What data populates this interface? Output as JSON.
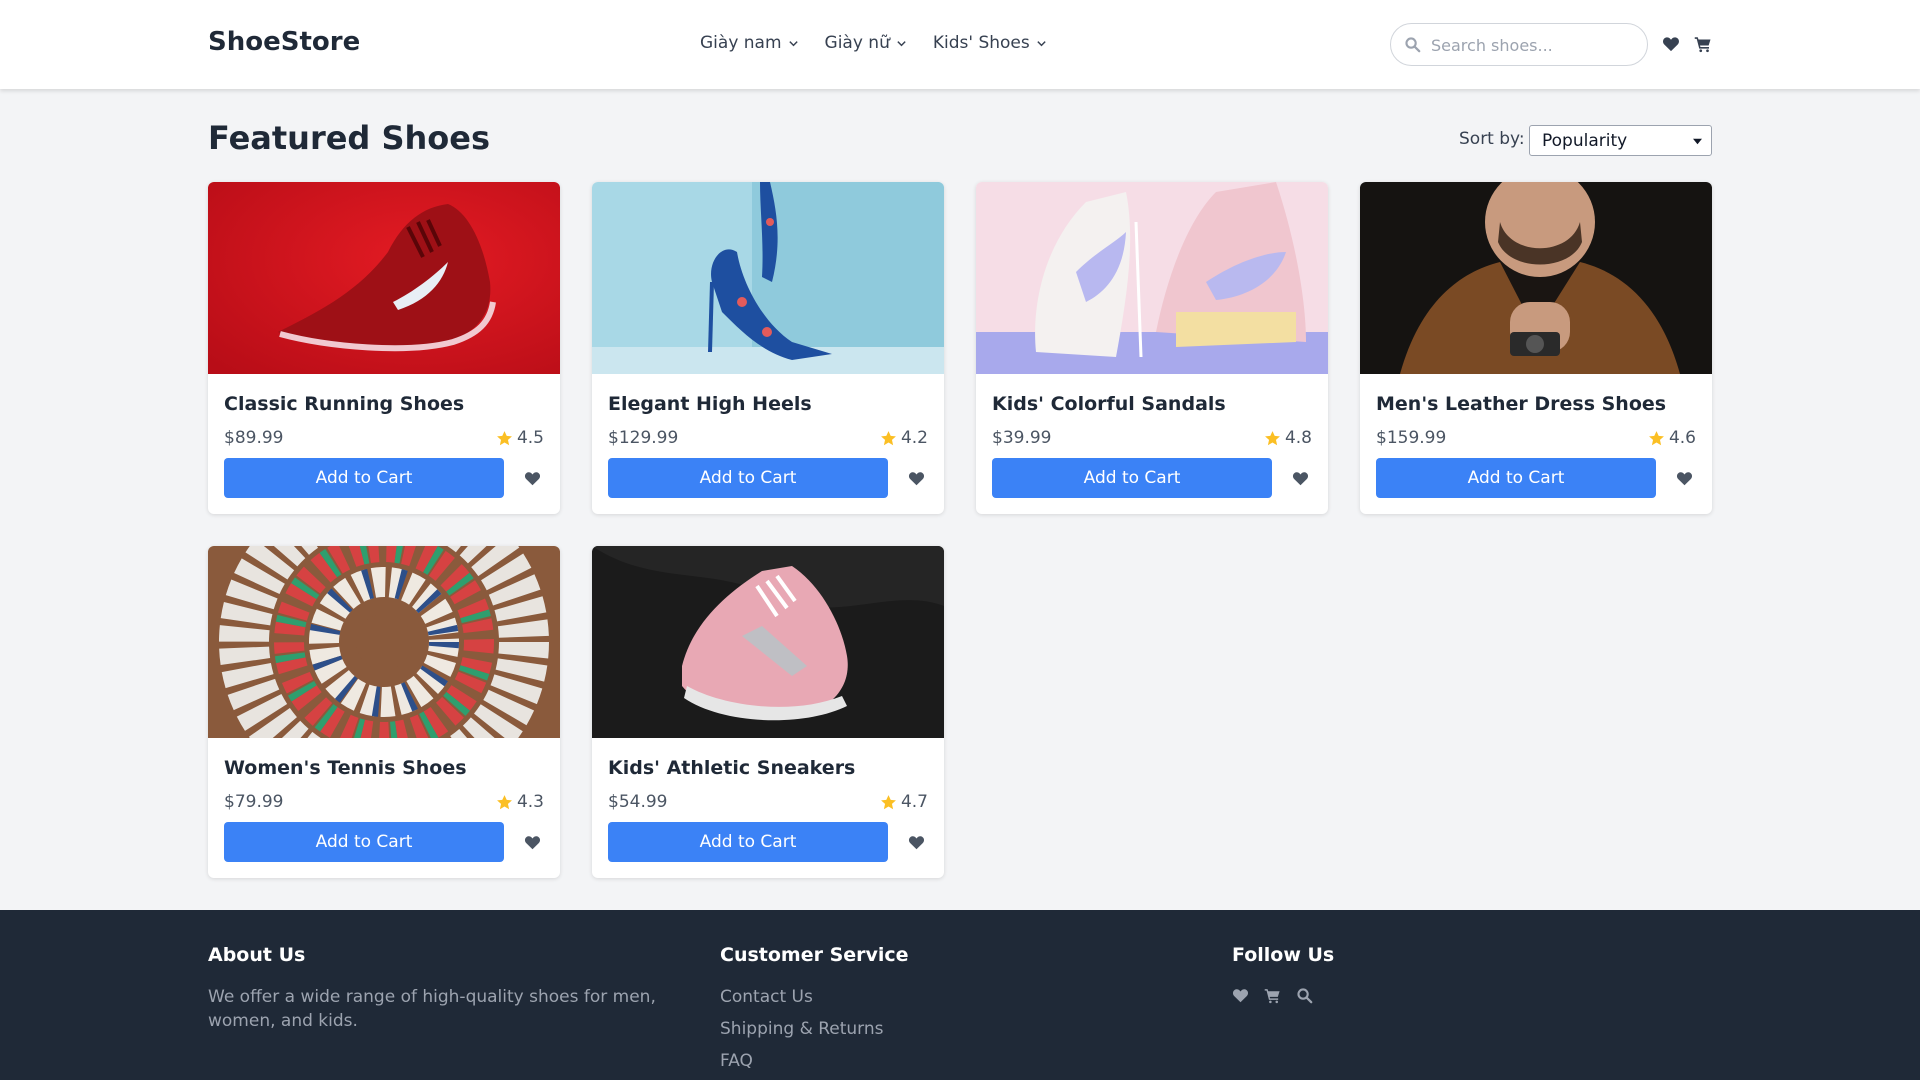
{
  "header": {
    "logo": "ShoeStore",
    "nav": [
      {
        "label": "Giày nam"
      },
      {
        "label": "Giày nữ"
      },
      {
        "label": "Kids' Shoes"
      }
    ],
    "search_placeholder": "Search shoes...",
    "icons": [
      "heart-icon",
      "cart-icon"
    ]
  },
  "main": {
    "title": "Featured Shoes",
    "sort": {
      "label": "Sort by:",
      "selected": "Popularity"
    }
  },
  "products": [
    {
      "name": "Classic Running Shoes",
      "price": "$89.99",
      "rating": "4.5",
      "button": "Add to Cart"
    },
    {
      "name": "Elegant High Heels",
      "price": "$129.99",
      "rating": "4.2",
      "button": "Add to Cart"
    },
    {
      "name": "Kids' Colorful Sandals",
      "price": "$39.99",
      "rating": "4.8",
      "button": "Add to Cart"
    },
    {
      "name": "Men's Leather Dress Shoes",
      "price": "$159.99",
      "rating": "4.6",
      "button": "Add to Cart"
    },
    {
      "name": "Women's Tennis Shoes",
      "price": "$79.99",
      "rating": "4.3",
      "button": "Add to Cart"
    },
    {
      "name": "Kids' Athletic Sneakers",
      "price": "$54.99",
      "rating": "4.7",
      "button": "Add to Cart"
    }
  ],
  "footer": {
    "about": {
      "heading": "About Us",
      "text": "We offer a wide range of high-quality shoes for men, women, and kids."
    },
    "service": {
      "heading": "Customer Service",
      "links": [
        "Contact Us",
        "Shipping & Returns",
        "FAQ"
      ]
    },
    "follow": {
      "heading": "Follow Us",
      "icons": [
        "heart-icon",
        "cart-icon",
        "search-icon"
      ]
    }
  },
  "colors": {
    "primary": "#3b82f6",
    "star": "#fbbf24",
    "footer_bg": "#1f2937",
    "page_bg": "#f3f4f6"
  }
}
